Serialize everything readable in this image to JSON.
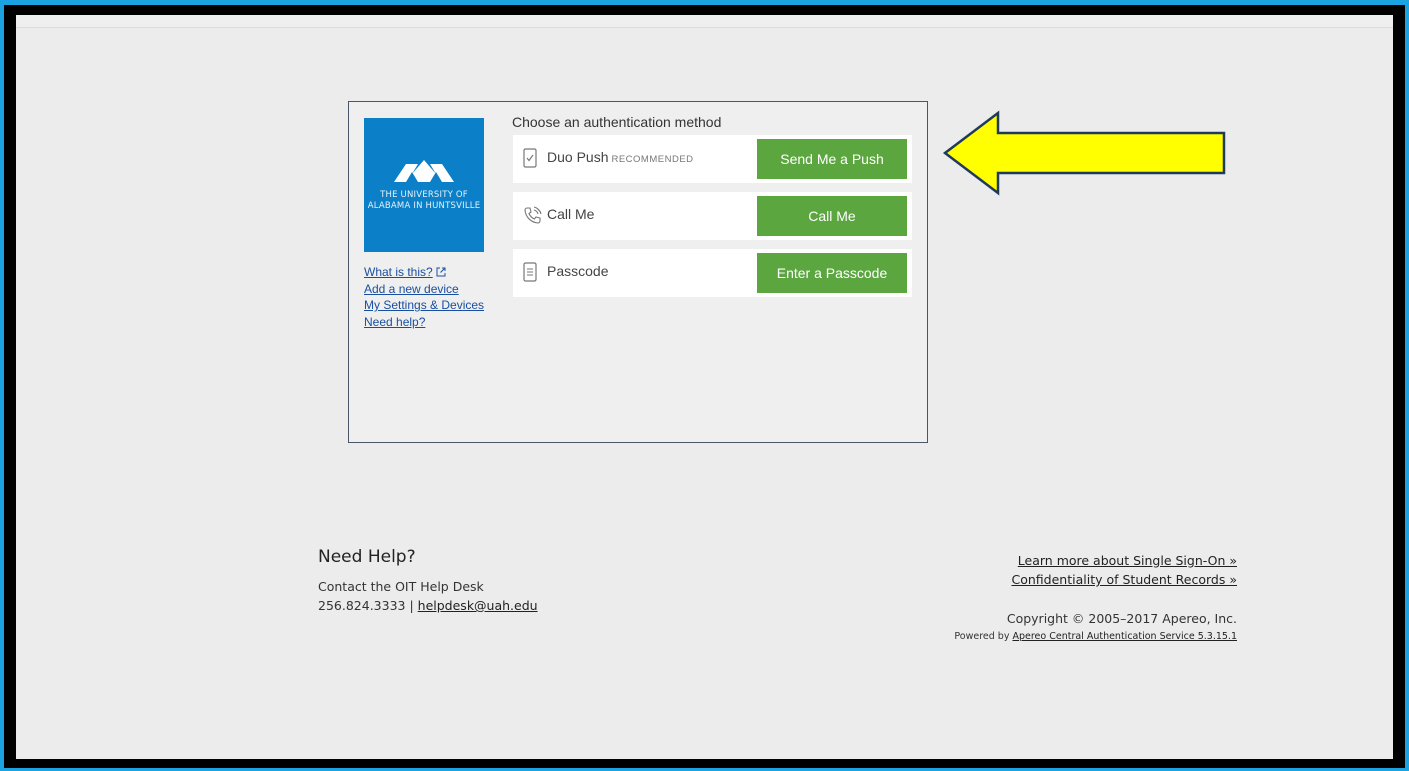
{
  "logo": {
    "line1": "THE UNIVERSITY OF",
    "line2": "ALABAMA IN HUNTSVILLE",
    "brand_color": "#0b80c8"
  },
  "links": {
    "what_is_this": "What is this?",
    "add_device": "Add a new device",
    "settings": "My Settings & Devices",
    "need_help": "Need help?"
  },
  "auth": {
    "title": "Choose an authentication method",
    "methods": [
      {
        "label": "Duo Push",
        "sub": "RECOMMENDED",
        "button": "Send Me a Push",
        "icon": "phone-check-icon"
      },
      {
        "label": "Call Me",
        "sub": "",
        "button": "Call Me",
        "icon": "phone-call-icon"
      },
      {
        "label": "Passcode",
        "sub": "",
        "button": "Enter a Passcode",
        "icon": "passcode-icon"
      }
    ],
    "button_color": "#5ba63f"
  },
  "annotation": {
    "arrow_color": "#ffff00",
    "arrow_icon": "yellow-arrow-left-icon"
  },
  "footer": {
    "help_title": "Need Help?",
    "contact": "Contact the OIT Help Desk",
    "phone": "256.824.3333",
    "separator": " | ",
    "email": "helpdesk@uah.edu",
    "learn_sso": "Learn more about Single Sign-On »",
    "confidentiality": "Confidentiality of Student Records »",
    "copyright": "Copyright © 2005–2017 Apereo, Inc.",
    "powered_prefix": "Powered by ",
    "powered_link": "Apereo Central Authentication Service 5.3.15.1"
  }
}
